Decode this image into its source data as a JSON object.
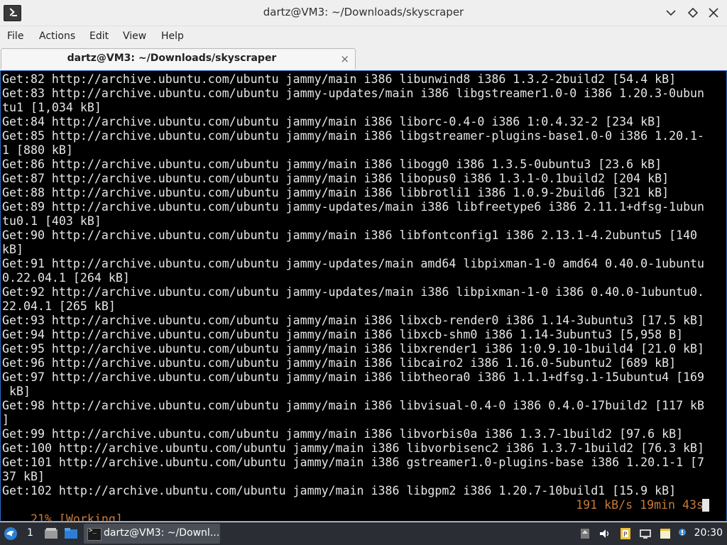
{
  "window": {
    "title": "dartz@VM3: ~/Downloads/skyscraper",
    "icon": "terminal-icon",
    "controls": [
      "minimize-icon",
      "maximize-icon",
      "close-icon"
    ]
  },
  "menu": {
    "file": "File",
    "actions": "Actions",
    "edit": "Edit",
    "view": "View",
    "help": "Help"
  },
  "tab": {
    "label": "dartz@VM3: ~/Downloads/skyscraper",
    "close": "×"
  },
  "terminal": {
    "lines": [
      "Get:82 http://archive.ubuntu.com/ubuntu jammy/main i386 libunwind8 i386 1.3.2-2build2 [54.4 kB]",
      "Get:83 http://archive.ubuntu.com/ubuntu jammy-updates/main i386 libgstreamer1.0-0 i386 1.20.3-0ubun",
      "tu1 [1,034 kB]",
      "Get:84 http://archive.ubuntu.com/ubuntu jammy/main i386 liborc-0.4-0 i386 1:0.4.32-2 [234 kB]",
      "Get:85 http://archive.ubuntu.com/ubuntu jammy/main i386 libgstreamer-plugins-base1.0-0 i386 1.20.1-",
      "1 [880 kB]",
      "Get:86 http://archive.ubuntu.com/ubuntu jammy/main i386 libogg0 i386 1.3.5-0ubuntu3 [23.6 kB]",
      "Get:87 http://archive.ubuntu.com/ubuntu jammy/main i386 libopus0 i386 1.3.1-0.1build2 [204 kB]",
      "Get:88 http://archive.ubuntu.com/ubuntu jammy/main i386 libbrotli1 i386 1.0.9-2build6 [321 kB]",
      "Get:89 http://archive.ubuntu.com/ubuntu jammy-updates/main i386 libfreetype6 i386 2.11.1+dfsg-1ubun",
      "tu0.1 [403 kB]",
      "Get:90 http://archive.ubuntu.com/ubuntu jammy/main i386 libfontconfig1 i386 2.13.1-4.2ubuntu5 [140",
      "kB]",
      "Get:91 http://archive.ubuntu.com/ubuntu jammy-updates/main amd64 libpixman-1-0 amd64 0.40.0-1ubuntu",
      "0.22.04.1 [264 kB]",
      "Get:92 http://archive.ubuntu.com/ubuntu jammy-updates/main i386 libpixman-1-0 i386 0.40.0-1ubuntu0.",
      "22.04.1 [265 kB]",
      "Get:93 http://archive.ubuntu.com/ubuntu jammy/main i386 libxcb-render0 i386 1.14-3ubuntu3 [17.5 kB]",
      "Get:94 http://archive.ubuntu.com/ubuntu jammy/main i386 libxcb-shm0 i386 1.14-3ubuntu3 [5,958 B]",
      "Get:95 http://archive.ubuntu.com/ubuntu jammy/main i386 libxrender1 i386 1:0.9.10-1build4 [21.0 kB]",
      "Get:96 http://archive.ubuntu.com/ubuntu jammy/main i386 libcairo2 i386 1.16.0-5ubuntu2 [689 kB]",
      "Get:97 http://archive.ubuntu.com/ubuntu jammy/main i386 libtheora0 i386 1.1.1+dfsg.1-15ubuntu4 [169",
      " kB]",
      "Get:98 http://archive.ubuntu.com/ubuntu jammy/main i386 libvisual-0.4-0 i386 0.4.0-17build2 [117 kB",
      "]",
      "Get:99 http://archive.ubuntu.com/ubuntu jammy/main i386 libvorbis0a i386 1.3.7-1build2 [97.6 kB]",
      "Get:100 http://archive.ubuntu.com/ubuntu jammy/main i386 libvorbisenc2 i386 1.3.7-1build2 [76.3 kB]",
      "Get:101 http://archive.ubuntu.com/ubuntu jammy/main i386 gstreamer1.0-plugins-base i386 1.20.1-1 [7",
      "37 kB]",
      "Get:102 http://archive.ubuntu.com/ubuntu jammy/main i386 libgpm2 i386 1.20.7-10build1 [15.9 kB]"
    ],
    "status_left": "21% [Working]",
    "status_right": "191 kB/s 19min 43s"
  },
  "taskbar": {
    "start_icon": "start-menu-icon",
    "workspace": "1",
    "task_label": "dartz@VM3: ~/Downl...",
    "clock": "20:30",
    "tray_icons": [
      "storage-icon",
      "volume-icon",
      "clipboard-icon",
      "network-icon",
      "notes-icon",
      "update-notifier-icon"
    ]
  }
}
